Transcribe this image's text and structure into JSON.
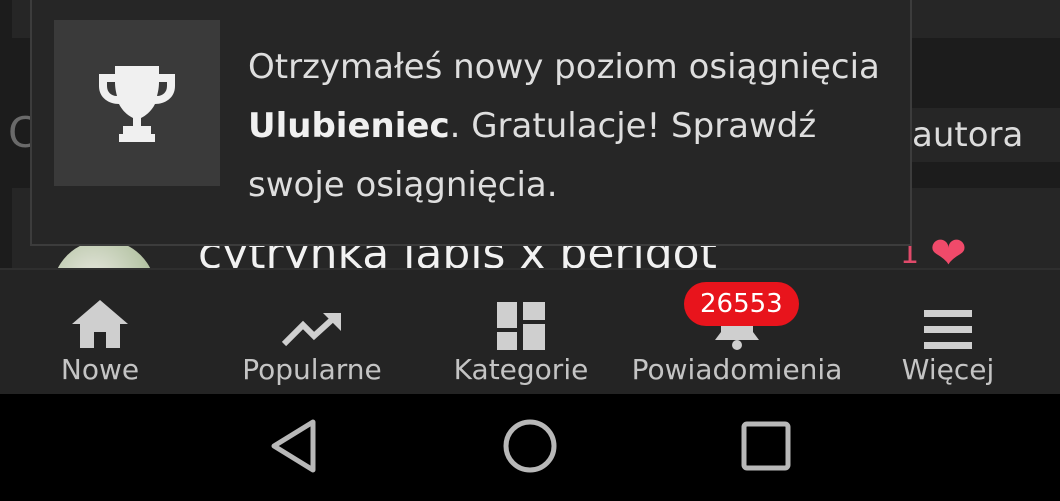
{
  "background": {
    "row_left_glyph": "C",
    "row_right_label": "autora",
    "card_title": "cytrynka lapis x perigot",
    "card_count": "1",
    "card_heart_icon": "heart-icon"
  },
  "toast": {
    "icon": "trophy-icon",
    "message_part1": "Otrzymałeś nowy poziom osiągnięcia ",
    "message_bold": "Ulubieniec",
    "message_part2": ". Gratulacje! Sprawdź swoje osiągnięcia."
  },
  "bottom_nav": {
    "items": [
      {
        "label": "Nowe",
        "icon": "home-icon"
      },
      {
        "label": "Popularne",
        "icon": "trending-icon"
      },
      {
        "label": "Kategorie",
        "icon": "dashboard-icon"
      },
      {
        "label": "Powiadomienia",
        "icon": "bell-icon",
        "badge": "26553"
      },
      {
        "label": "Więcej",
        "icon": "menu-icon"
      }
    ]
  },
  "system_nav": {
    "back_icon": "back-triangle-icon",
    "home_icon": "home-circle-icon",
    "recents_icon": "recents-square-icon"
  },
  "colors": {
    "badge": "#e8141c",
    "heart": "#f04a6a",
    "toast_bg": "#262626",
    "nav_bg": "#242424"
  }
}
